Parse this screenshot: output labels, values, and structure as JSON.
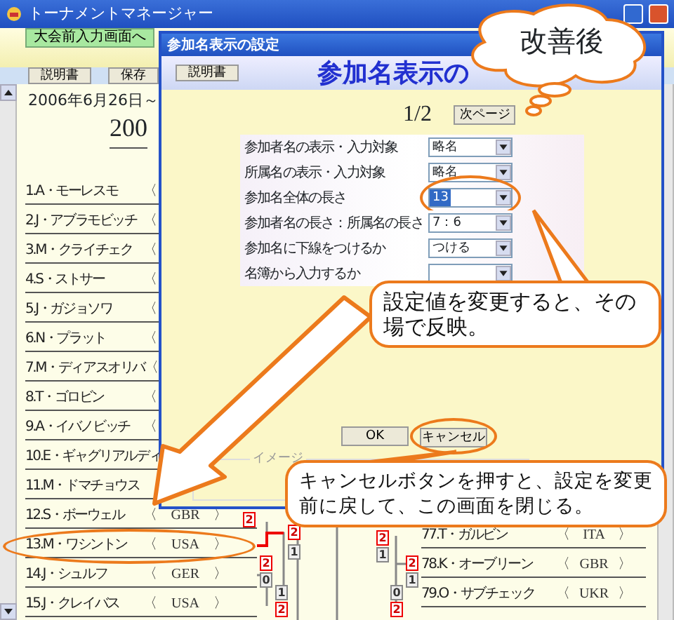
{
  "window": {
    "title": "トーナメントマネージャー"
  },
  "toolbar": {
    "nav_button": "大会前入力画面へ",
    "buttons": [
      "説明書",
      "保存"
    ]
  },
  "main": {
    "date": "2006年6月26日～",
    "heading": "200",
    "entries": [
      {
        "name": "1.A・モーレスモ",
        "open": "〈",
        "circled": false
      },
      {
        "name": "2.J・アブラモビッチ",
        "open": "〈",
        "circled": false
      },
      {
        "name": "3.M・クライチェク",
        "open": "〈",
        "circled": false
      },
      {
        "name": "4.S・ストサー",
        "open": "〈",
        "circled": false
      },
      {
        "name": "5.J・ガジョソワ",
        "open": "〈",
        "circled": false
      },
      {
        "name": "6.N・プラット",
        "open": "〈",
        "circled": false
      },
      {
        "name": "7.M・ディアスオリバ",
        "open": "〈",
        "circled": false
      },
      {
        "name": "8.T・ゴロビン",
        "open": "〈",
        "circled": false
      },
      {
        "name": "9.A・イバノビッチ",
        "open": "〈",
        "circled": false
      },
      {
        "name": "10.E・ギャグリアルディ",
        "circled": false
      },
      {
        "name": "11.M・ドマチョウス",
        "circled": false
      },
      {
        "name": "12.S・ボーウェル",
        "open": "〈",
        "country": "GBR",
        "close": "〉",
        "circled": false
      },
      {
        "name": "13.M・ワシントン",
        "open": "〈",
        "country": "USA",
        "close": "〉",
        "circled": true
      },
      {
        "name": "14.J・シュルフ",
        "open": "〈",
        "country": "GER",
        "close": "〉",
        "circled": false
      },
      {
        "name": "15.J・クレイバス",
        "open": "〈",
        "country": "USA",
        "close": "〉",
        "circled": false
      }
    ],
    "scores": [
      {
        "value": "2",
        "winner": true
      },
      {
        "value": "2",
        "winner": true
      },
      {
        "value": "1",
        "winner": false
      },
      {
        "value": "2",
        "winner": true
      },
      {
        "value": "0",
        "winner": false
      },
      {
        "value": "1",
        "winner": false
      },
      {
        "value": "2",
        "winner": true
      },
      {
        "value": "2",
        "winner": true
      },
      {
        "value": "1",
        "winner": false
      },
      {
        "value": "2",
        "winner": true
      },
      {
        "value": "1",
        "winner": false
      },
      {
        "value": "0",
        "winner": false
      },
      {
        "value": "2",
        "winner": true
      }
    ],
    "right_entries": [
      {
        "name": "77.T・ガルビン",
        "open": "〈",
        "country": "ITA",
        "close": "〉"
      },
      {
        "name": "78.K・オーブリーン",
        "open": "〈",
        "country": "GBR",
        "close": "〉"
      },
      {
        "name": "79.O・サブチェック",
        "open": "〈",
        "country": "UKR",
        "close": "〉"
      }
    ]
  },
  "dialog": {
    "title": "参加名表示の設定",
    "manual_button": "説明書",
    "heading": "参加名表示の",
    "page": "1/2",
    "next_button": "次ページ",
    "settings": [
      {
        "label": "参加者名の表示・入力対象",
        "value": "略名",
        "value_selected": false,
        "circled": false
      },
      {
        "label": "所属名の表示・入力対象",
        "value": "略名",
        "value_selected": false,
        "circled": false
      },
      {
        "label": "参加名全体の長さ",
        "value": "13",
        "value_selected": true,
        "circled": true
      },
      {
        "label": "参加者名の長さ：所属名の長さ",
        "value": "7：6",
        "value_selected": false,
        "circled": false
      },
      {
        "label": "参加名に下線をつけるか",
        "value": "つける",
        "value_selected": false,
        "circled": false
      },
      {
        "label": "名簿から入力するか",
        "circled": false
      }
    ],
    "ok_button": "OK",
    "cancel_button": "キャンセル",
    "cancel_circled": true,
    "image_legend": "イメージ"
  },
  "annotations": {
    "cloud": "改善後",
    "callouts": [
      "設定値を変更すると、その場で反映。",
      "キャンセルボタンを押すと、設定を変更前に戻して、この画面を閉じる。"
    ]
  }
}
